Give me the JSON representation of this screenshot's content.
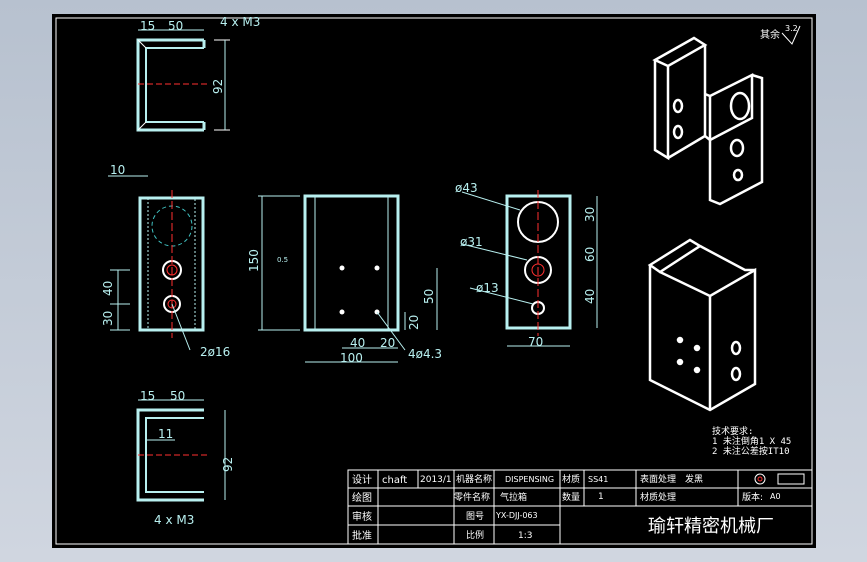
{
  "sheet": {
    "roughness": "3.2",
    "roughness_label": "其余",
    "notes_title": "技术要求:",
    "notes": [
      "1 未注倒角1 X 45",
      "2 未注公差按IT10"
    ]
  },
  "title_block": {
    "design_label": "设计",
    "designer": "chaft",
    "date": "2013/1",
    "machine_name_label": "机器名称",
    "machine_name": "DISPENSING",
    "material_label": "材质",
    "material": "SS41",
    "surface_label": "表面处理",
    "surface": "发黑",
    "drawing_label": "绘图",
    "part_name_label": "零件名称",
    "part_name": "气拉箱",
    "quantity_label": "数量",
    "quantity": "1",
    "heat_label": "材质处理",
    "version_label": "版本:",
    "version": "A0",
    "review_label": "审核",
    "drawing_no_label": "图号",
    "drawing_no": "YX-DJJ-063",
    "approve_label": "批准",
    "scale_label": "比例",
    "scale": "1:3",
    "company": "瑜轩精密机械厂"
  },
  "dims": {
    "top_15": "15",
    "top_50": "50",
    "top_thread": "4 x M3",
    "top_92": "92",
    "side_10": "10",
    "side_40": "40",
    "side_30": "30",
    "side_hole": "2ø16",
    "front_150": "150",
    "front_100": "100",
    "front_40": "40",
    "front_20a": "20",
    "front_20b": "20",
    "front_50": "50",
    "front_holes": "4ø4.3",
    "front_small": "0.5",
    "right_d43": "ø43",
    "right_d31": "ø31",
    "right_d13": "ø13",
    "right_30": "30",
    "right_60": "60",
    "right_40": "40",
    "right_70": "70",
    "bot_15": "15",
    "bot_50": "50",
    "bot_11": "11",
    "bot_92": "92",
    "bot_thread": "4 x M3"
  }
}
